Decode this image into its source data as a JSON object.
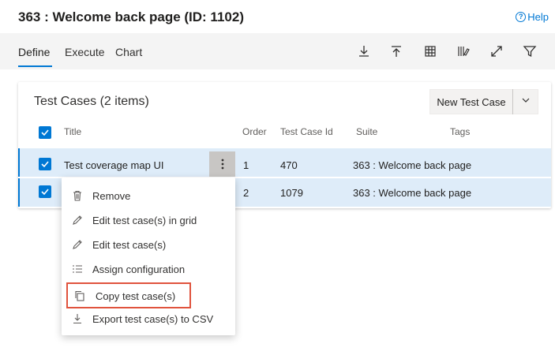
{
  "header": {
    "title": "363 : Welcome back page (ID: 1102)",
    "help_label": "Help",
    "help_icon": "?"
  },
  "tabs": [
    {
      "label": "Define",
      "active": true
    },
    {
      "label": "Execute",
      "active": false
    },
    {
      "label": "Chart",
      "active": false
    }
  ],
  "toolbar": {
    "icons": [
      "download-icon",
      "upload-icon",
      "grid-icon",
      "column-options-icon",
      "fullscreen-icon",
      "filter-icon"
    ]
  },
  "test_cases": {
    "title": "Test Cases (2 items)",
    "new_button_label": "New Test Case",
    "columns": [
      "Title",
      "Order",
      "Test Case Id",
      "Suite",
      "Tags"
    ],
    "rows": [
      {
        "title": "Test coverage map UI",
        "order": "1",
        "id": "470",
        "suite": "363 : Welcome back page",
        "tags": ""
      },
      {
        "title": "",
        "order": "2",
        "id": "1079",
        "suite": "363 : Welcome back page",
        "tags": ""
      }
    ]
  },
  "context_menu": {
    "items": [
      {
        "label": "Remove",
        "icon": "trash-icon"
      },
      {
        "label": "Edit test case(s) in grid",
        "icon": "pencil-icon"
      },
      {
        "label": "Edit test case(s)",
        "icon": "pencil-icon"
      },
      {
        "label": "Assign configuration",
        "icon": "list-icon"
      },
      {
        "label": "Copy test case(s)",
        "icon": "copy-icon"
      },
      {
        "label": "Export test case(s) to CSV",
        "icon": "download-icon"
      }
    ]
  },
  "colors": {
    "accent": "#0078d4",
    "selected_row": "#deecf9",
    "highlight_border": "#e0533d"
  }
}
